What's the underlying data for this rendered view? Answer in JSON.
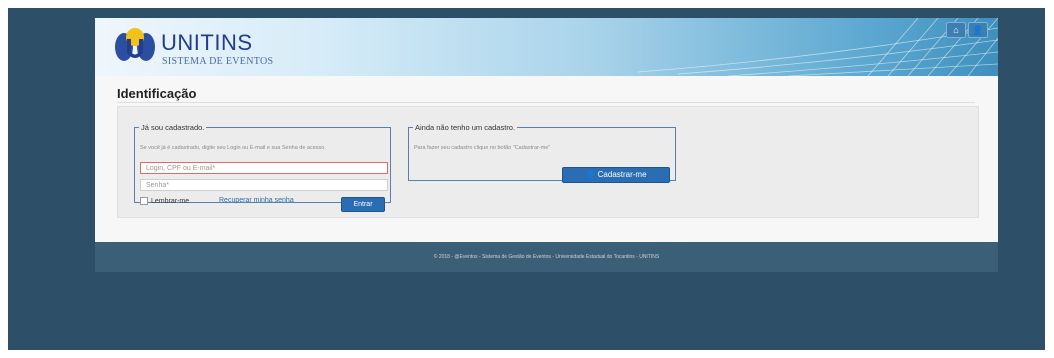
{
  "header": {
    "brand": "UNITINS",
    "subtitle": "SISTEMA DE EVENTOS",
    "icons": [
      "home-icon",
      "user-icon"
    ],
    "home_glyph": "⌂",
    "user_glyph": "👤"
  },
  "page": {
    "title": "Identificação"
  },
  "login_panel": {
    "legend": "Já sou cadastrado.",
    "help": "Se você já é cadastrado, digite seu Login ou E-mail e sua Senha de acesso.",
    "login_placeholder": "Login, CPF ou E-mail*",
    "password_placeholder": "Senha*",
    "remember_label": "Lembrar-me",
    "recover_link": "Recuperar minha senha",
    "submit_label": "Entrar"
  },
  "register_panel": {
    "legend": "Ainda não tenho um cadastro.",
    "help": "Para fazer seu cadastro clique no botão \"Cadastrar-me\"",
    "button_label": "Cadastrar-me",
    "button_glyph": "👤"
  },
  "footer": {
    "text": "© 2018 - @Eventos - Sistema de Gestão de Eventos - Universidade Estadual do Tocantins - UNITINS"
  },
  "colors": {
    "background": "#2d5068",
    "primary_button": "#2a6db3",
    "error_border": "#e36a6a"
  }
}
